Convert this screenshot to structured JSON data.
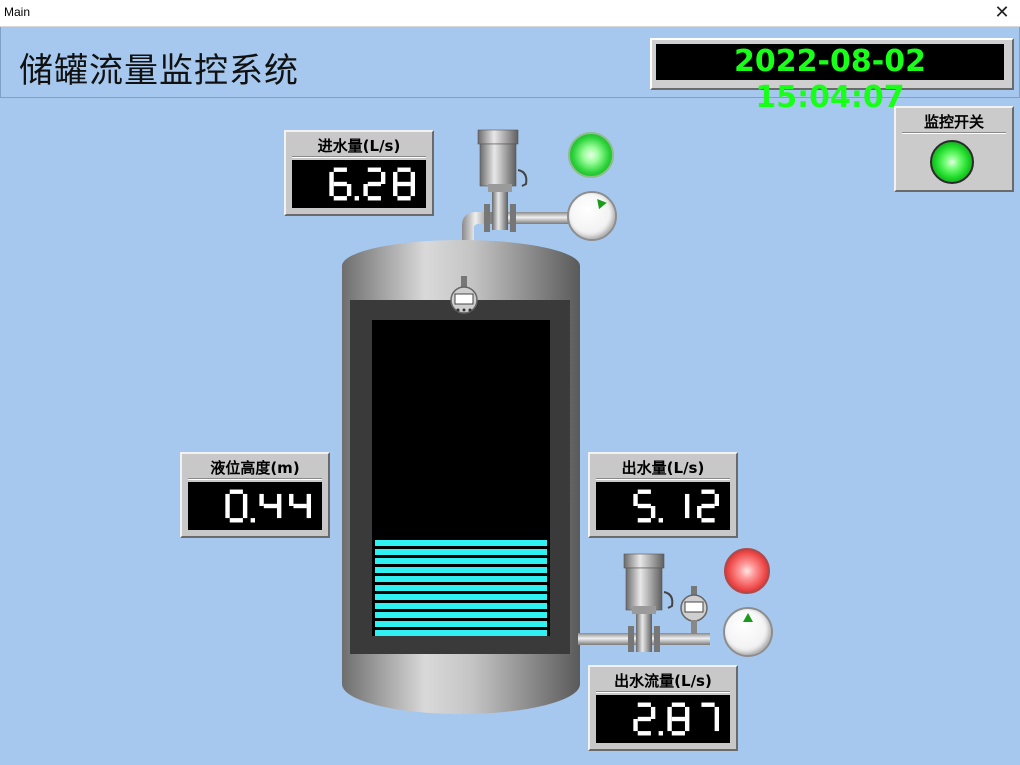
{
  "window": {
    "title": "Main",
    "close_glyph": "✕"
  },
  "app": {
    "title": "储罐流量监控系统",
    "datetime": "2022-08-02 15:04:07"
  },
  "monitor_switch": {
    "label": "监控开关",
    "state": "on",
    "lamp_color": "#1fdc2a"
  },
  "inlet": {
    "label": "进水量(L/s)",
    "value": "6.28",
    "lamp": "green"
  },
  "level": {
    "label": "液位高度(m)",
    "value": "0.44",
    "fill_fraction": 0.32
  },
  "outlet": {
    "label": "出水量(L/s)",
    "value": "5.12"
  },
  "outflow": {
    "label": "出水流量(L/s)",
    "value": "2.87",
    "lamp": "red"
  },
  "colors": {
    "background": "#a6c8ee",
    "clock_text": "#18ff18",
    "liquid": "#2ff1f1",
    "lamp_green": "#22e02c",
    "lamp_red": "#ff5a5a"
  },
  "icons": {
    "close": "close-icon",
    "valve": "valve-icon",
    "gauge": "pressure-gauge-icon",
    "sensor": "level-sensor-icon",
    "tank": "storage-tank-icon"
  }
}
